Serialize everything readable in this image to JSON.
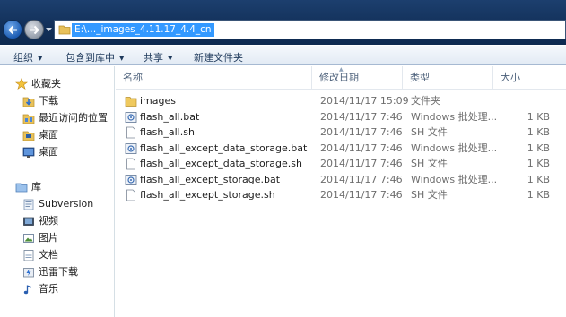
{
  "address": {
    "path": "E:\\…_images_4.11.17_4.4_cn"
  },
  "toolbar": {
    "organize": "组织",
    "include_in_library": "包含到库中",
    "share": "共享",
    "new_folder": "新建文件夹"
  },
  "sidebar": {
    "favorites": "收藏夹",
    "favorites_items": [
      "下载",
      "最近访问的位置",
      "桌面",
      "桌面"
    ],
    "libraries": "库",
    "library_items": [
      "Subversion",
      "视频",
      "图片",
      "文档",
      "迅雷下载",
      "音乐"
    ]
  },
  "columns": {
    "name": "名称",
    "date": "修改日期",
    "type": "类型",
    "size": "大小"
  },
  "files": [
    {
      "name": "images",
      "date": "2014/11/17 15:09",
      "type": "文件夹",
      "size": "",
      "icon": "folder-icon"
    },
    {
      "name": "flash_all.bat",
      "date": "2014/11/17 7:46",
      "type": "Windows 批处理...",
      "size": "1 KB",
      "icon": "batch-file-icon"
    },
    {
      "name": "flash_all.sh",
      "date": "2014/11/17 7:46",
      "type": "SH 文件",
      "size": "1 KB",
      "icon": "text-file-icon"
    },
    {
      "name": "flash_all_except_data_storage.bat",
      "date": "2014/11/17 7:46",
      "type": "Windows 批处理...",
      "size": "1 KB",
      "icon": "batch-file-icon"
    },
    {
      "name": "flash_all_except_data_storage.sh",
      "date": "2014/11/17 7:46",
      "type": "SH 文件",
      "size": "1 KB",
      "icon": "text-file-icon"
    },
    {
      "name": "flash_all_except_storage.bat",
      "date": "2014/11/17 7:46",
      "type": "Windows 批处理...",
      "size": "1 KB",
      "icon": "batch-file-icon"
    },
    {
      "name": "flash_all_except_storage.sh",
      "date": "2014/11/17 7:46",
      "type": "SH 文件",
      "size": "1 KB",
      "icon": "text-file-icon"
    }
  ],
  "colors": {
    "selection": "#3399ff",
    "titlebar": "#123059",
    "toolbar_text": "#1e395b"
  }
}
